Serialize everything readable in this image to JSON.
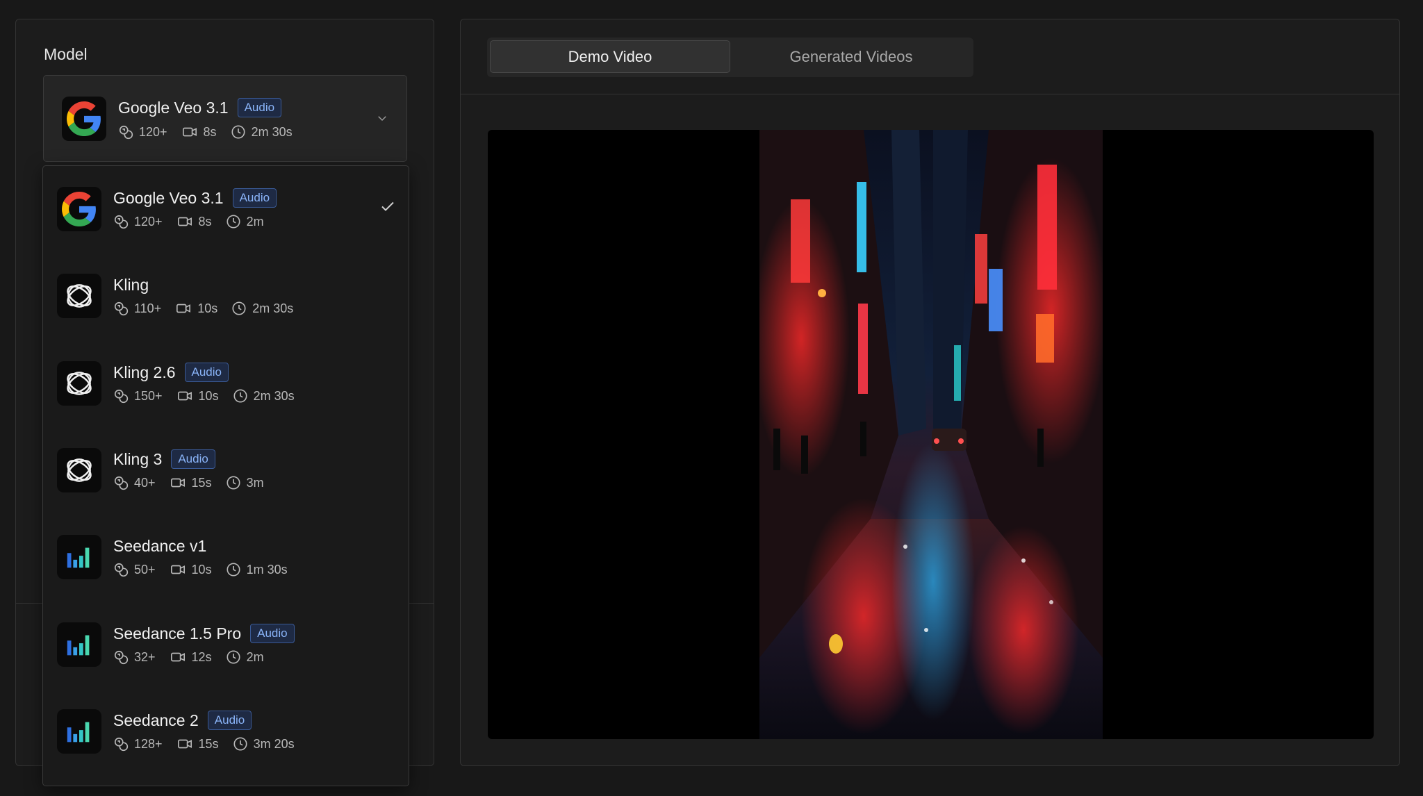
{
  "left": {
    "model_label": "Model"
  },
  "selected": {
    "name": "Google Veo 3.1",
    "badge": "Audio",
    "meta": {
      "count": "120+",
      "duration": "8s",
      "time": "2m 30s"
    },
    "logo": "google-logo"
  },
  "options": [
    {
      "name": "Google Veo 3.1",
      "badge": "Audio",
      "count": "120+",
      "duration": "8s",
      "time": "2m",
      "logo": "google-logo",
      "selected": true
    },
    {
      "name": "Kling",
      "badge": "",
      "count": "110+",
      "duration": "10s",
      "time": "2m 30s",
      "logo": "kling-logo",
      "selected": false
    },
    {
      "name": "Kling 2.6",
      "badge": "Audio",
      "count": "150+",
      "duration": "10s",
      "time": "2m 30s",
      "logo": "kling-logo",
      "selected": false
    },
    {
      "name": "Kling 3",
      "badge": "Audio",
      "count": "40+",
      "duration": "15s",
      "time": "3m",
      "logo": "kling-logo",
      "selected": false
    },
    {
      "name": "Seedance v1",
      "badge": "",
      "count": "50+",
      "duration": "10s",
      "time": "1m 30s",
      "logo": "seedance-logo",
      "selected": false
    },
    {
      "name": "Seedance 1.5 Pro",
      "badge": "Audio",
      "count": "32+",
      "duration": "12s",
      "time": "2m",
      "logo": "seedance-logo",
      "selected": false
    },
    {
      "name": "Seedance 2",
      "badge": "Audio",
      "count": "128+",
      "duration": "15s",
      "time": "3m 20s",
      "logo": "seedance-logo",
      "selected": false
    }
  ],
  "tabs": {
    "demo": "Demo Video",
    "generated": "Generated Videos",
    "active": "demo"
  },
  "icons": {
    "count": "coins-icon",
    "duration": "video-camera-icon",
    "time": "clock-icon",
    "chevron": "chevron-down-icon",
    "check": "checkmark-icon"
  },
  "colors": {
    "badge_text": "#8ab4f8",
    "badge_bg": "#1e2a44",
    "panel_bg": "#1c1c1c",
    "page_bg": "#181818"
  }
}
